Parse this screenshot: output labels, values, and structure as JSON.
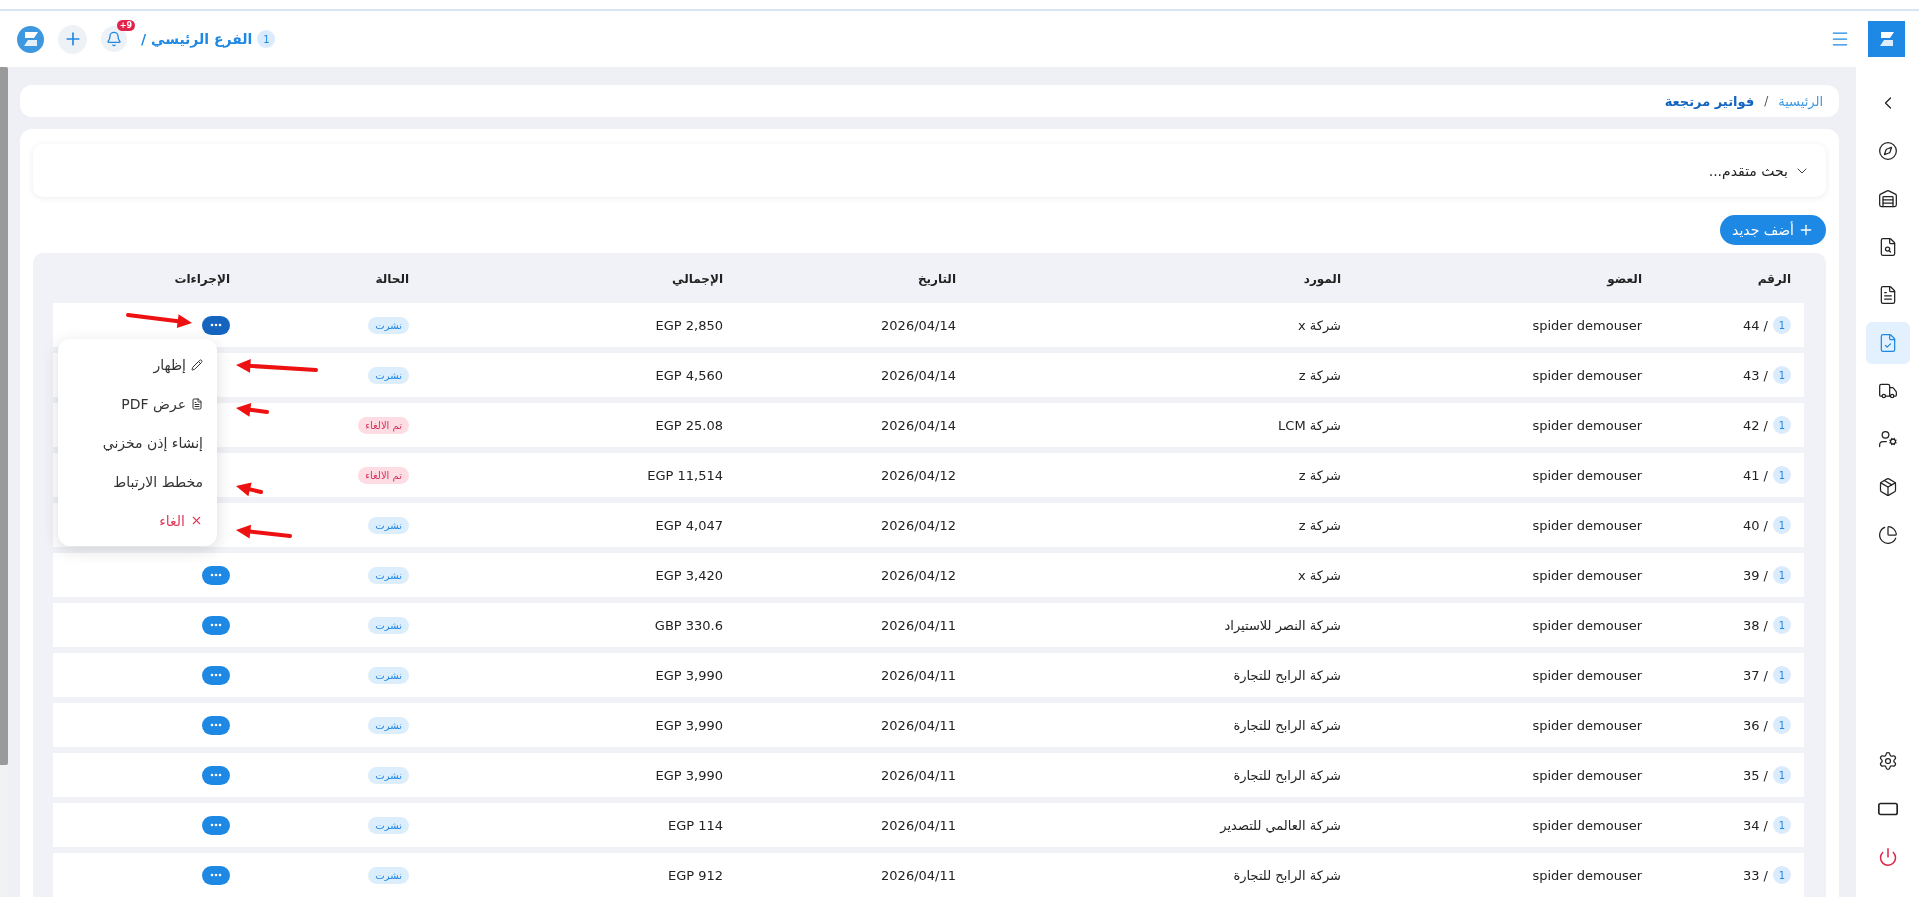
{
  "topbar": {
    "branch": {
      "badge": "1",
      "label": "الفرع الرئيسي /"
    },
    "notifications": {
      "badge": "+9"
    }
  },
  "sidebar": {
    "items": [
      {
        "selected": false
      },
      {
        "selected": false
      },
      {
        "selected": false
      },
      {
        "selected": false
      },
      {
        "selected": false
      },
      {
        "selected": true
      },
      {
        "selected": false
      },
      {
        "selected": false
      },
      {
        "selected": false
      },
      {
        "selected": false
      }
    ]
  },
  "breadcrumb": {
    "separator": "/",
    "items": [
      {
        "label": "الرئيسية",
        "current": false
      },
      {
        "label": "فواتير مرتجعة",
        "current": true
      }
    ]
  },
  "search": {
    "label": "بحث متقدم...",
    "expanded": false
  },
  "add_button": "أضف جديد",
  "table": {
    "columns": [
      "الرقم",
      "العضو",
      "المورد",
      "التاريخ",
      "الإجمالي",
      "الحالة",
      "الإجراءات"
    ],
    "rows": [
      {
        "number_badge": "1",
        "number": "/ 44",
        "member": "spider demouser",
        "supplier": "شركة x",
        "date": "2026/04/14",
        "total": "EGP 2,850",
        "status": {
          "label": "نشرت",
          "kind": "published"
        },
        "menu_open": true,
        "button_visible": true
      },
      {
        "number_badge": "1",
        "number": "/ 43",
        "member": "spider demouser",
        "supplier": "شركة z",
        "date": "2026/04/14",
        "total": "EGP 4,560",
        "status": {
          "label": "نشرت",
          "kind": "published"
        },
        "menu_open": false,
        "button_visible": false
      },
      {
        "number_badge": "1",
        "number": "/ 42",
        "member": "spider demouser",
        "supplier": "شركة LCM",
        "date": "2026/04/14",
        "total": "EGP 25.08",
        "status": {
          "label": "تم الالغاء",
          "kind": "cancelled"
        },
        "menu_open": false,
        "button_visible": false
      },
      {
        "number_badge": "1",
        "number": "/ 41",
        "member": "spider demouser",
        "supplier": "شركة z",
        "date": "2026/04/12",
        "total": "EGP 11,514",
        "status": {
          "label": "تم الالغاء",
          "kind": "cancelled"
        },
        "menu_open": false,
        "button_visible": false
      },
      {
        "number_badge": "1",
        "number": "/ 40",
        "member": "spider demouser",
        "supplier": "شركة z",
        "date": "2026/04/12",
        "total": "EGP 4,047",
        "status": {
          "label": "نشرت",
          "kind": "published"
        },
        "menu_open": false,
        "button_visible": false
      },
      {
        "number_badge": "1",
        "number": "/ 39",
        "member": "spider demouser",
        "supplier": "شركة x",
        "date": "2026/04/12",
        "total": "EGP 3,420",
        "status": {
          "label": "نشرت",
          "kind": "published"
        },
        "menu_open": false,
        "button_visible": true
      },
      {
        "number_badge": "1",
        "number": "/ 38",
        "member": "spider demouser",
        "supplier": "شركة النصر للاستيراد",
        "date": "2026/04/11",
        "total": "GBP 330.6",
        "status": {
          "label": "نشرت",
          "kind": "published"
        },
        "menu_open": false,
        "button_visible": true
      },
      {
        "number_badge": "1",
        "number": "/ 37",
        "member": "spider demouser",
        "supplier": "شركة الرابح للتجارة",
        "date": "2026/04/11",
        "total": "EGP 3,990",
        "status": {
          "label": "نشرت",
          "kind": "published"
        },
        "menu_open": false,
        "button_visible": true
      },
      {
        "number_badge": "1",
        "number": "/ 36",
        "member": "spider demouser",
        "supplier": "شركة الرابح للتجارة",
        "date": "2026/04/11",
        "total": "EGP 3,990",
        "status": {
          "label": "نشرت",
          "kind": "published"
        },
        "menu_open": false,
        "button_visible": true
      },
      {
        "number_badge": "1",
        "number": "/ 35",
        "member": "spider demouser",
        "supplier": "شركة الرابح للتجارة",
        "date": "2026/04/11",
        "total": "EGP 3,990",
        "status": {
          "label": "نشرت",
          "kind": "published"
        },
        "menu_open": false,
        "button_visible": true
      },
      {
        "number_badge": "1",
        "number": "/ 34",
        "member": "spider demouser",
        "supplier": "شركة العالمي للتصدير",
        "date": "2026/04/11",
        "total": "EGP 114",
        "status": {
          "label": "نشرت",
          "kind": "published"
        },
        "menu_open": false,
        "button_visible": true
      },
      {
        "number_badge": "1",
        "number": "/ 33",
        "member": "spider demouser",
        "supplier": "شركة الرابح للتجارة",
        "date": "2026/04/11",
        "total": "EGP 912",
        "status": {
          "label": "نشرت",
          "kind": "published"
        },
        "menu_open": false,
        "button_visible": true
      }
    ]
  },
  "menu": {
    "items": [
      {
        "label": "إظهار",
        "kind": "edit"
      },
      {
        "label": "عرض PDF",
        "kind": "pdf"
      },
      {
        "label": "إنشاء إذن مخزني",
        "kind": "plain"
      },
      {
        "label": "مخطط الارتباط",
        "kind": "plain"
      },
      {
        "label": "الغاء",
        "kind": "danger"
      }
    ]
  }
}
